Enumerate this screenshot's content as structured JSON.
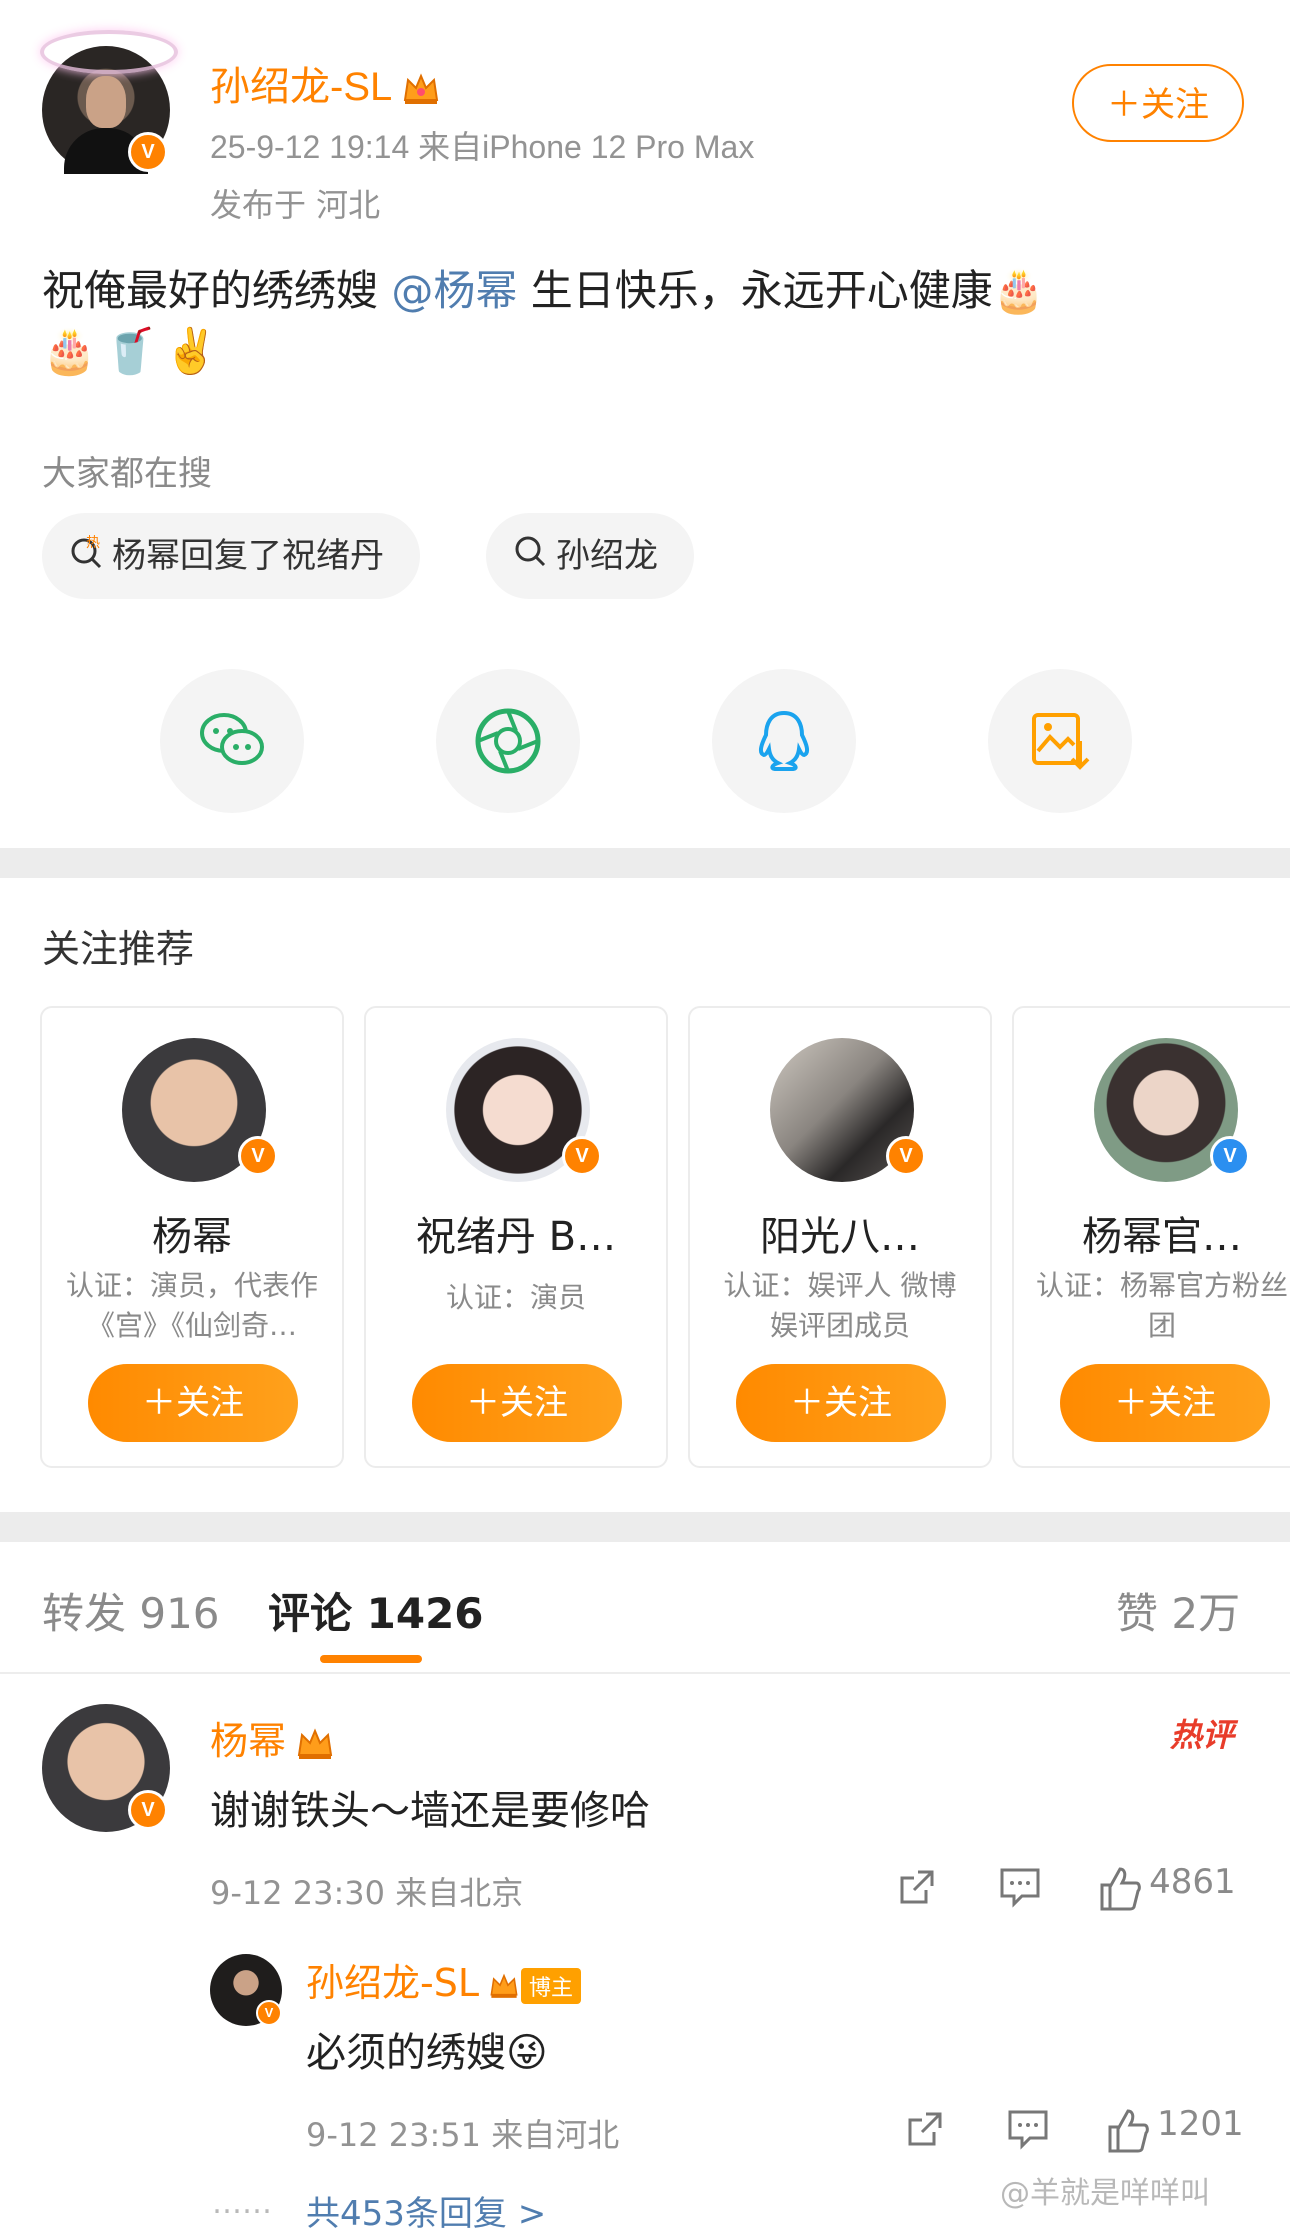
{
  "post": {
    "username": "孙绍龙-SL",
    "meta": "25-9-12 19:14  来自iPhone 12 Pro Max",
    "location": "发布于 河北",
    "follow_label": "＋关注",
    "text_before": "祝俺最好的绣绣嫂 ",
    "mention": "@杨幂",
    "text_after": " 生日快乐，永远开心健康🎂",
    "emoji_line": "🎂🥤✌️"
  },
  "search": {
    "title": "大家都在搜",
    "chips": [
      "杨幂回复了祝绪丹",
      "孙绍龙"
    ]
  },
  "share": {
    "icons": [
      "wechat-icon",
      "moments-icon",
      "qq-icon",
      "save-image-icon"
    ]
  },
  "recommend": {
    "title": "关注推荐",
    "cards": [
      {
        "name": "杨幂",
        "desc": "认证：演员，代表作《宫》《仙剑奇…",
        "follow": "＋关注"
      },
      {
        "name": "祝绪丹 B…",
        "desc": "认证：演员",
        "follow": "＋关注"
      },
      {
        "name": "阳光八…",
        "desc": "认证：娱评人 微博娱评团成员",
        "follow": "＋关注"
      },
      {
        "name": "杨幂官…",
        "desc": "认证：杨幂官方粉丝团",
        "follow": "＋关注"
      }
    ]
  },
  "tabs": {
    "repost": "转发 916",
    "comment": "评论 1426",
    "like": "赞 2万"
  },
  "comment": {
    "name": "杨幂",
    "hot": "热评",
    "text": "谢谢铁头～墙还是要修哈",
    "meta": "9-12 23:30 来自北京",
    "likes": "4861"
  },
  "reply": {
    "name": "孙绍龙-SL",
    "tag": "博主",
    "text": "必须的绣嫂😜",
    "meta": "9-12 23:51 来自河北",
    "likes": "1201",
    "more": "共453条回复 >"
  },
  "watermark": "@羊就是咩咩叫",
  "colors": {
    "accent": "#ff8200",
    "link": "#507daf",
    "muted": "#939393"
  }
}
